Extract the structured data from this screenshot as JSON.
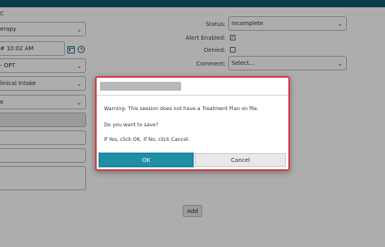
{
  "left_form": {
    "section_label": "C",
    "service": "erapy",
    "datetime": "# 10:02 AM",
    "program": "- OPT",
    "visit_type": "linical Intake",
    "location": "e"
  },
  "right_form": {
    "status_label": "Status:",
    "status_value": "Incomplete",
    "alert_label": "Alert Enabled:",
    "alert_checked": true,
    "denied_label": "Denied:",
    "denied_checked": false,
    "comment_label": "Comment:",
    "comment_value": "Select..."
  },
  "add_label": "Add",
  "dialog": {
    "message_warning": "Warning: This session does not have a Treatment Plan on file.",
    "message_question": "Do you want to save?",
    "message_instruction": "If Yes, click OK. If No, click Cancel.",
    "ok_label": "OK",
    "cancel_label": "Cancel"
  },
  "colors": {
    "topbar": "#0f5d6e",
    "ok_button": "#1f8fa6",
    "dialog_border": "#d63a43"
  },
  "icons": {
    "calendar": "calendar-icon",
    "clock": "clock-icon",
    "dropdown": "chevron-down-icon",
    "checkbox": "checkmark-icon"
  }
}
